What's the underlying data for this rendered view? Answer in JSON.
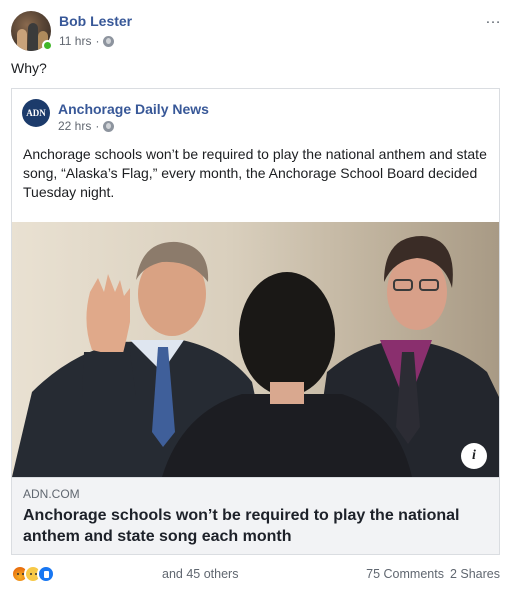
{
  "post": {
    "author": "Bob Lester",
    "time": "11 hrs",
    "separator": "·",
    "text": "Why?",
    "more_icon": "…"
  },
  "shared": {
    "source_logo": "ADN",
    "source_name": "Anchorage Daily News",
    "time": "22 hrs",
    "separator": "·",
    "text": "Anchorage schools won’t be required to play the national anthem and state song, “Alaska’s Flag,” every month, the Anchorage School Board decided Tuesday night.",
    "link": {
      "info_icon": "i",
      "domain": "ADN.COM",
      "title": "Anchorage schools won’t be required to play the national anthem and state song each month"
    }
  },
  "engagement": {
    "reactions": [
      "angry-icon",
      "sad-icon",
      "like-icon"
    ],
    "others": "and 45 others",
    "comments": "75 Comments",
    "shares": "2 Shares"
  },
  "colors": {
    "link_blue": "#385898",
    "meta_gray": "#616770",
    "online_green": "#42b72a",
    "like_blue": "#1877f2"
  }
}
